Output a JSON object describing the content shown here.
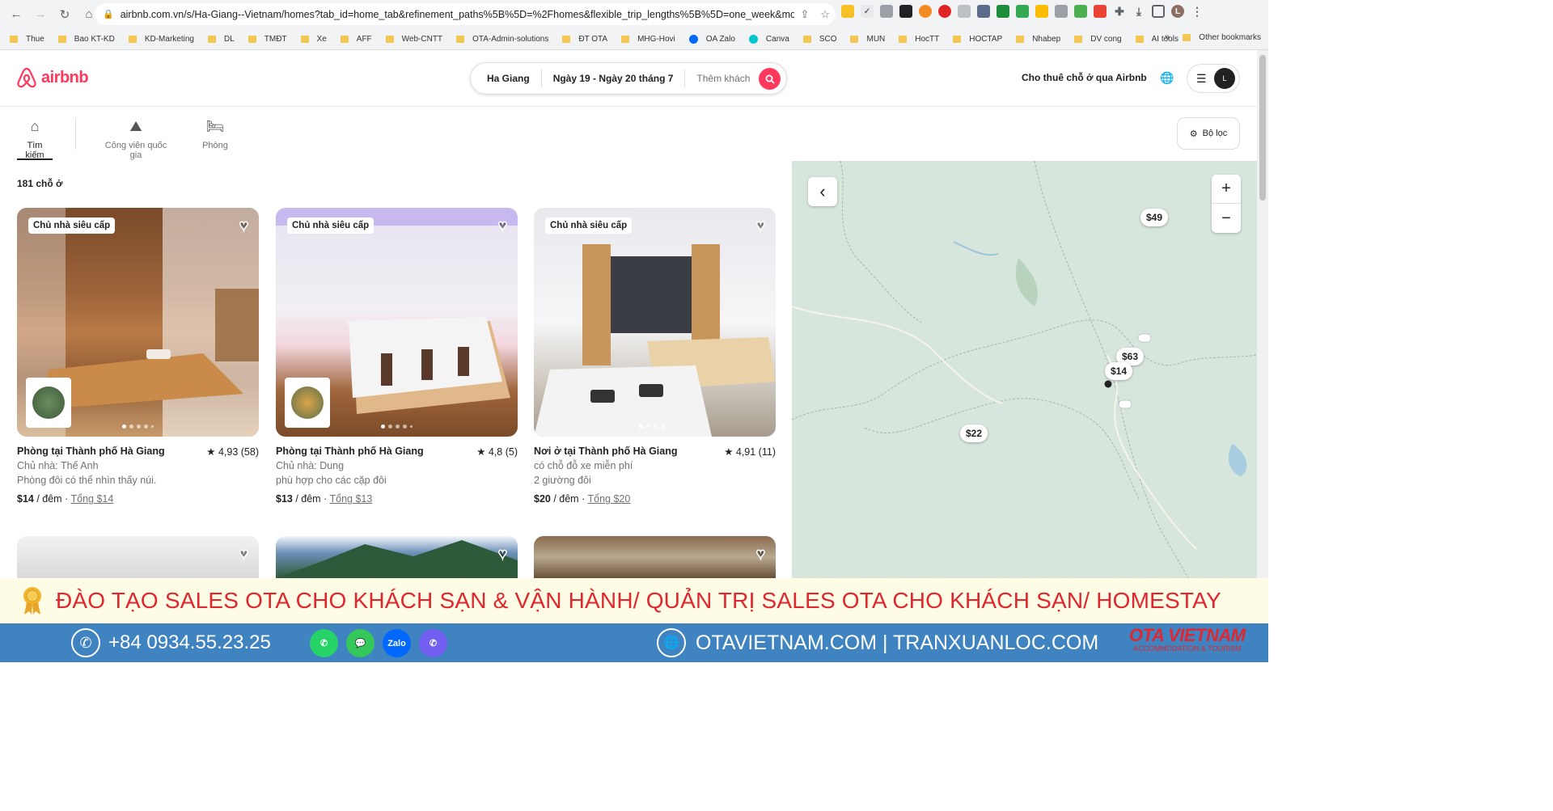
{
  "browser": {
    "url": "airbnb.com.vn/s/Ha-Giang--Vietnam/homes?tab_id=home_tab&refinement_paths%5B%5D=%2Fhomes&flexible_trip_lengths%5B%5D=one_week&mon...",
    "bookmarks": [
      "Thue",
      "Bao KT-KD",
      "KD-Marketing",
      "DL",
      "TMĐT",
      "Xe",
      "AFF",
      "Web-CNTT",
      "OTA-Admin-solutions",
      "ĐT OTA",
      "MHG-Hovi",
      "OA Zalo",
      "Canva",
      "SCO",
      "MUN",
      "HocTT",
      "HOCTAP",
      "Nhabep",
      "DV cong",
      "AI tools"
    ],
    "other_bookmarks": "Other bookmarks",
    "more": "»",
    "avatar_letter": "L"
  },
  "header": {
    "logo_text": "airbnb",
    "search_location": "Ha Giang",
    "search_dates": "Ngày 19 - Ngày 20 tháng 7",
    "search_guests": "Thêm khách",
    "host_link": "Cho thuê chỗ ở qua Airbnb",
    "user_initial": "L"
  },
  "categories": [
    {
      "label": "Tìm kiếm",
      "icon": "home-icon"
    },
    {
      "label": "Công viên quốc gia",
      "icon": "park-icon"
    },
    {
      "label": "Phòng",
      "icon": "bed-icon"
    }
  ],
  "filter_label": "Bộ lọc",
  "results_count": "181 chỗ ở",
  "listings": [
    {
      "badge": "Chủ nhà siêu cấp",
      "title": "Phòng tại Thành phố Hà Giang",
      "rating": "★ 4,93 (58)",
      "line1": "Chủ nhà: Thế Anh",
      "line2": "Phòng đôi có thể nhìn thấy núi.",
      "price": "$14",
      "per": " / đêm · ",
      "total": "Tổng $14"
    },
    {
      "badge": "Chủ nhà siêu cấp",
      "title": "Phòng tại Thành phố Hà Giang",
      "rating": "★ 4,8 (5)",
      "line1": "Chủ nhà: Dung",
      "line2": "phù hợp cho các cặp đôi",
      "price": "$13",
      "per": " / đêm · ",
      "total": "Tổng $13"
    },
    {
      "badge": "Chủ nhà siêu cấp",
      "title": "Nơi ở tại Thành phố Hà Giang",
      "rating": "★ 4,91 (11)",
      "line1": "có chỗ đỗ xe miễn phí",
      "line2": "2 giường đôi",
      "price": "$20",
      "per": " / đêm · ",
      "total": "Tổng $20"
    }
  ],
  "map": {
    "pins": [
      "$49",
      "$63",
      "$14",
      "$22"
    ],
    "zoom_in": "+",
    "zoom_out": "−",
    "back": "‹"
  },
  "banner": {
    "text": "ĐÀO TẠO SALES OTA CHO KHÁCH SẠN & VẬN HÀNH/ QUẢN TRỊ SALES OTA CHO KHÁCH SẠN/ HOMESTAY"
  },
  "footer": {
    "phone": "+84 0934.55.23.25",
    "apps": [
      "WhatsApp",
      "Messages",
      "Zalo",
      "Viber"
    ],
    "zalo_label": "Zalo",
    "websites": "OTAVIETNAM.COM | TRANXUANLOC.COM",
    "logo_big": "OTA VIETNAM",
    "logo_small": "ACCOMMODATION & TOURISM"
  }
}
